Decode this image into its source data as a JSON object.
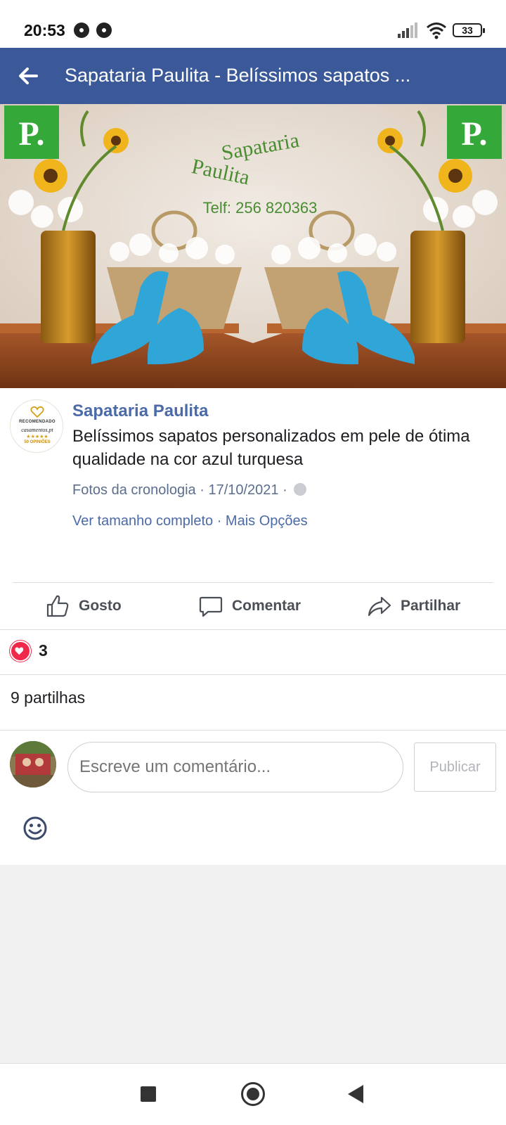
{
  "status_bar": {
    "time": "20:53",
    "battery": "33",
    "icons": [
      "chrome-icon",
      "chrome-icon",
      "signal-icon",
      "wifi-icon",
      "battery-icon"
    ]
  },
  "header": {
    "title": "Sapataria Paulita - Belíssimos sapatos ...",
    "back_icon": "back-arrow-icon",
    "background": "#3b5998"
  },
  "photo": {
    "logo_letter": "P.",
    "brand_line1": "Sapataria",
    "brand_line2": "Paulita",
    "phone": "Telf: 256 820363"
  },
  "post": {
    "badge": {
      "recommended": "RECOMENDADO",
      "site": "casamentos.pt",
      "stars": "★★★★★",
      "opinions": "50 OPINIÕES"
    },
    "author": "Sapataria Paulita",
    "caption": "Belíssimos sapatos personalizados em pele de ótima qualidade na cor azul turquesa",
    "album": "Fotos da cronologia",
    "date": "17/10/2021",
    "view_full": "Ver tamanho completo",
    "more_options": "Mais Opções",
    "link_color": "#4b6aa8"
  },
  "actions": {
    "like": "Gosto",
    "comment": "Comentar",
    "share": "Partilhar"
  },
  "reactions": {
    "count": "3",
    "heart_color": "#f0284a"
  },
  "shares_text": "9 partilhas",
  "comment": {
    "placeholder": "Escreve um comentário...",
    "publish": "Publicar"
  }
}
